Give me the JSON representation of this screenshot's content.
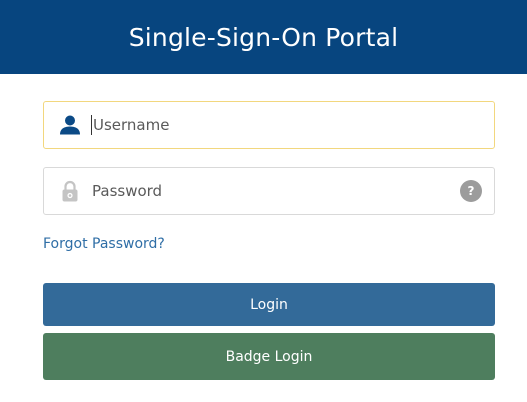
{
  "header": {
    "title": "Single-Sign-On Portal"
  },
  "login_form": {
    "username": {
      "icon": "user-icon",
      "placeholder": "Username",
      "value": ""
    },
    "password": {
      "icon": "lock-icon",
      "placeholder": "Password",
      "value": "",
      "help_label": "?"
    },
    "forgot_password_label": "Forgot Password?",
    "login_button_label": "Login",
    "badge_login_button_label": "Badge Login"
  },
  "colors": {
    "header_bg": "#07457f",
    "login_button": "#336a99",
    "badge_button": "#4e7e5e",
    "link": "#2f6ea6",
    "focus_border": "#f2d77e"
  }
}
